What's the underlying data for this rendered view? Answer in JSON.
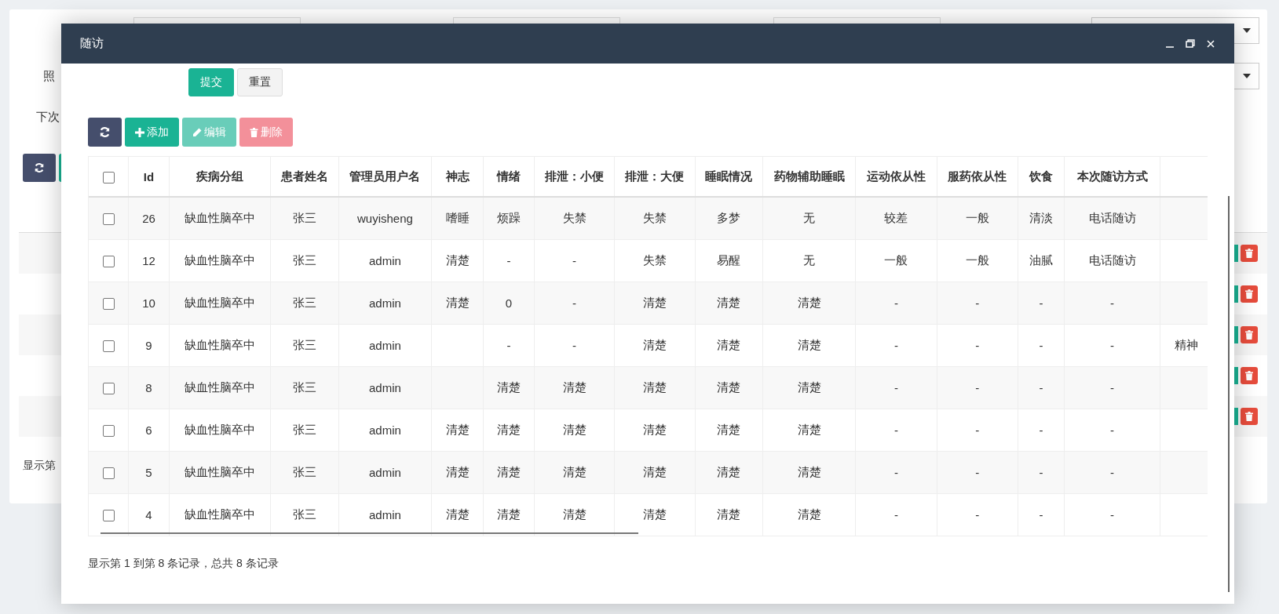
{
  "background": {
    "labels": [
      "照",
      "下次"
    ],
    "footer": "显示第",
    "row_actions": [
      {
        "kind": "edit-delete"
      },
      {
        "kind": "edit-delete"
      },
      {
        "kind": "edit-delete"
      },
      {
        "kind": "edit-delete"
      },
      {
        "kind": "edit-delete"
      }
    ]
  },
  "dialog": {
    "title": "随访",
    "form_buttons": [
      {
        "label": "提交",
        "kind": "primary"
      },
      {
        "label": "重置",
        "kind": "default"
      }
    ],
    "toolbar": [
      {
        "kind": "refresh",
        "disabled": false
      },
      {
        "kind": "add",
        "label": "添加",
        "disabled": false
      },
      {
        "kind": "edit",
        "label": "编辑",
        "disabled": true
      },
      {
        "kind": "delete",
        "label": "删除",
        "disabled": true
      }
    ],
    "table": {
      "header_checked": false,
      "columns": [
        "Id",
        "疾病分组",
        "患者姓名",
        "管理员用户名",
        "神志",
        "情绪",
        "排泄：小便",
        "排泄：大便",
        "睡眠情况",
        "药物辅助睡眠",
        "运动依从性",
        "服药依从性",
        "饮食",
        "本次随访方式"
      ],
      "rows": [
        {
          "checked": false,
          "cells": [
            "26",
            "缺血性脑卒中",
            "张三",
            "wuyisheng",
            "嗜睡",
            "烦躁",
            "失禁",
            "失禁",
            "多梦",
            "无",
            "较差",
            "一般",
            "清淡",
            "电话随访",
            null
          ]
        },
        {
          "checked": false,
          "cells": [
            "12",
            "缺血性脑卒中",
            "张三",
            "admin",
            "清楚",
            "-",
            "-",
            "失禁",
            "易醒",
            "无",
            "一般",
            "一般",
            "油腻",
            "电话随访",
            null
          ]
        },
        {
          "checked": false,
          "cells": [
            "10",
            "缺血性脑卒中",
            "张三",
            "admin",
            "清楚",
            "0",
            "-",
            "清楚",
            "清楚",
            "清楚",
            "-",
            "-",
            "-",
            "-",
            null
          ]
        },
        {
          "checked": false,
          "cells": [
            "9",
            "缺血性脑卒中",
            "张三",
            "admin",
            null,
            "-",
            "-",
            "清楚",
            "清楚",
            "清楚",
            "-",
            "-",
            "-",
            "-",
            "精神"
          ]
        },
        {
          "checked": false,
          "cells": [
            "8",
            "缺血性脑卒中",
            "张三",
            "admin",
            null,
            "清楚",
            "清楚",
            "清楚",
            "清楚",
            "清楚",
            "-",
            "-",
            "-",
            "-",
            null
          ]
        },
        {
          "checked": false,
          "cells": [
            "6",
            "缺血性脑卒中",
            "张三",
            "admin",
            "清楚",
            "清楚",
            "清楚",
            "清楚",
            "清楚",
            "清楚",
            "-",
            "-",
            "-",
            "-",
            null
          ]
        },
        {
          "checked": false,
          "cells": [
            "5",
            "缺血性脑卒中",
            "张三",
            "admin",
            "清楚",
            "清楚",
            "清楚",
            "清楚",
            "清楚",
            "清楚",
            "-",
            "-",
            "-",
            "-",
            null
          ]
        },
        {
          "checked": false,
          "cells": [
            "4",
            "缺血性脑卒中",
            "张三",
            "admin",
            "清楚",
            "清楚",
            "清楚",
            "清楚",
            "清楚",
            "清楚",
            "-",
            "-",
            "-",
            "-",
            null
          ]
        }
      ]
    },
    "footer": "显示第 1 到第 8 条记录，总共 8 条记录"
  }
}
